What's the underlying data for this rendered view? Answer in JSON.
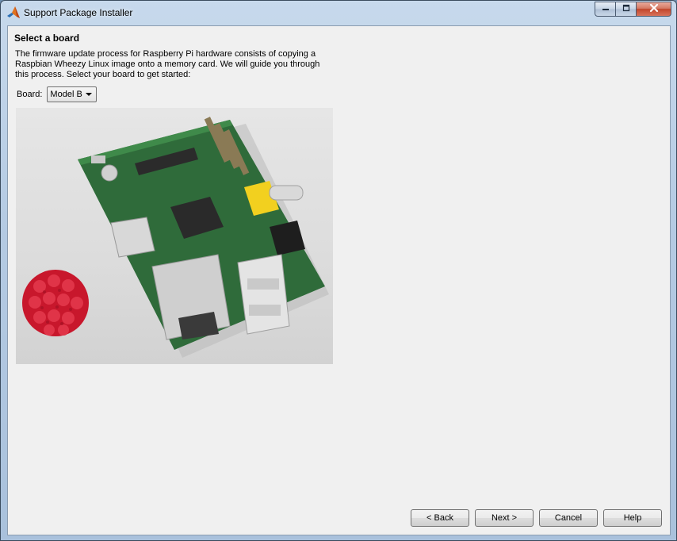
{
  "window": {
    "title": "Support Package Installer",
    "icon": "matlab-icon",
    "controls": {
      "minimize": "minimize-icon",
      "maximize": "maximize-icon",
      "close": "close-icon"
    }
  },
  "page": {
    "heading": "Select a board",
    "description_lines": [
      "The firmware update process for Raspberry Pi hardware consists of copying a",
      "Raspbian Wheezy Linux image onto a memory card. We will guide you through",
      "this process. Select your board to get started:"
    ],
    "board_label": "Board:",
    "board_selected": "Model B"
  },
  "buttons": {
    "back": "< Back",
    "next": "Next >",
    "cancel": "Cancel",
    "help": "Help"
  },
  "colors": {
    "titlebar": "#b5cbe3",
    "client_bg": "#f0f0f0",
    "close_button": "#c2462b"
  }
}
